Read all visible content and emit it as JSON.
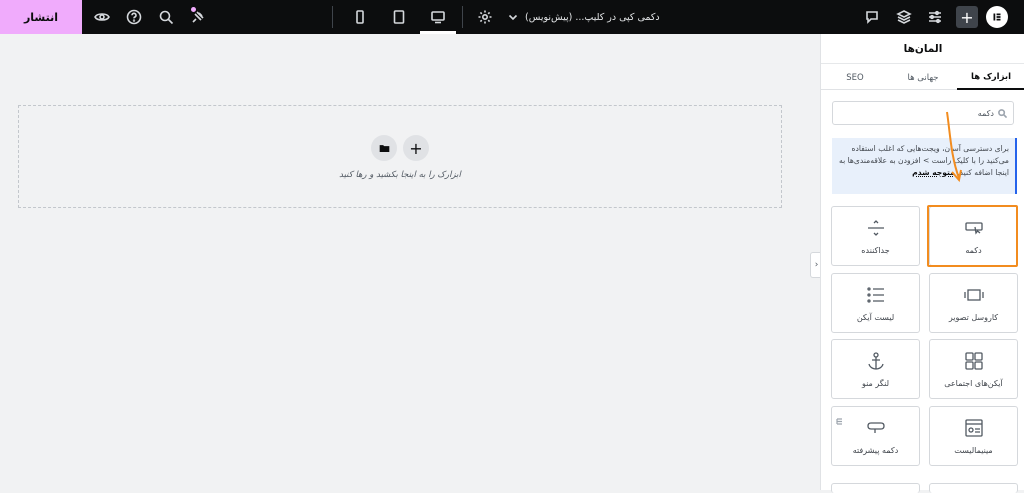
{
  "topbar": {
    "publish_label": "انتشار",
    "document_title": "دکمی کپی در کلیپ... (پیش‌نویس)",
    "icons": [
      "preview-eye-icon",
      "help-icon",
      "search-icon",
      "notes-icon",
      "desktop-icon",
      "tablet-icon",
      "mobile-icon",
      "settings-icon",
      "chevron-down-icon",
      "comments-icon",
      "structure-icon",
      "site-settings-icon",
      "add-element-icon",
      "elementor-logo-icon"
    ]
  },
  "canvas": {
    "drop_text": "ابزارک را به اینجا بکشید و رها کنید"
  },
  "panel": {
    "title": "المان‌ها",
    "tabs": [
      "ابزارک ها",
      "جهانی ها",
      "SEO"
    ],
    "search_value": "دکمه",
    "notice_text": "برای دسترسی آسان، ویجت‌هایی که اغلب استفاده می‌کنید را با کلیک راست > افزودن به علاقه‌مندی‌ها به اینجا اضافه کنید.",
    "notice_link": "متوجه شدم",
    "widgets": [
      {
        "label": "دکمه",
        "icon": "button-icon"
      },
      {
        "label": "جداکننده",
        "icon": "divider-icon"
      },
      {
        "label": "کاروسل تصویر",
        "icon": "image-carousel-icon"
      },
      {
        "label": "لیست آیکن",
        "icon": "icon-list-icon"
      },
      {
        "label": "آیکن‌های اجتماعی",
        "icon": "social-icons-icon"
      },
      {
        "label": "لنگر منو",
        "icon": "anchor-icon"
      },
      {
        "label": "مینیمالیست",
        "icon": "minimalist-icon"
      },
      {
        "label": "دکمه پیشرفته",
        "icon": "advanced-button-icon"
      }
    ]
  },
  "colors": {
    "publish_bg": "#f0abfc",
    "topbar_bg": "#0c0d0e",
    "highlight": "#f28c1f",
    "notice_border": "#2563eb"
  }
}
